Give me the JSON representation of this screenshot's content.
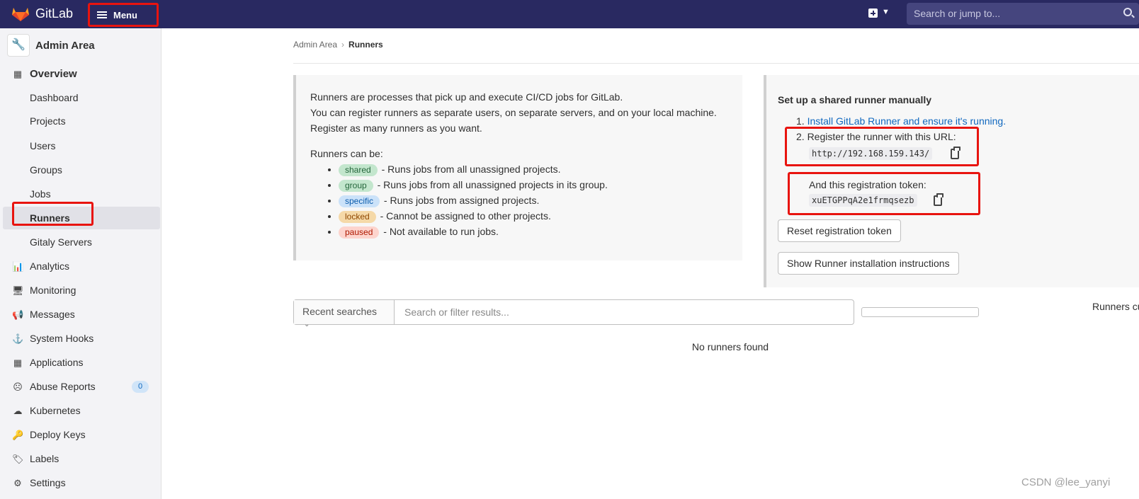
{
  "topbar": {
    "brand": "GitLab",
    "menu_label": "Menu",
    "search_placeholder": "Search or jump to..."
  },
  "sidebar": {
    "header": "Admin Area",
    "items": [
      {
        "label": "Overview",
        "icon": "overview-icon"
      },
      {
        "label": "Dashboard"
      },
      {
        "label": "Projects"
      },
      {
        "label": "Users"
      },
      {
        "label": "Groups"
      },
      {
        "label": "Jobs"
      },
      {
        "label": "Runners",
        "active": true
      },
      {
        "label": "Gitaly Servers"
      },
      {
        "label": "Analytics",
        "icon": "chart-icon"
      },
      {
        "label": "Monitoring",
        "icon": "monitor-icon"
      },
      {
        "label": "Messages",
        "icon": "megaphone-icon"
      },
      {
        "label": "System Hooks",
        "icon": "hook-icon"
      },
      {
        "label": "Applications",
        "icon": "grid-icon"
      },
      {
        "label": "Abuse Reports",
        "icon": "frown-icon",
        "badge": "0"
      },
      {
        "label": "Kubernetes",
        "icon": "kubernetes-icon"
      },
      {
        "label": "Deploy Keys",
        "icon": "key-icon"
      },
      {
        "label": "Labels",
        "icon": "label-icon"
      },
      {
        "label": "Settings",
        "icon": "gear-icon"
      }
    ]
  },
  "breadcrumb": {
    "parent": "Admin Area",
    "current": "Runners"
  },
  "info": {
    "line1": "Runners are processes that pick up and execute CI/CD jobs for GitLab.",
    "line2": "You can register runners as separate users, on separate servers, and on your local machine.",
    "line3": "Register as many runners as you want.",
    "can_be": "Runners can be:",
    "types": [
      {
        "pill": "shared",
        "desc": " - Runs jobs from all unassigned projects."
      },
      {
        "pill": "group",
        "desc": " - Runs jobs from all unassigned projects in its group."
      },
      {
        "pill": "specific",
        "desc": " - Runs jobs from assigned projects."
      },
      {
        "pill": "locked",
        "desc": " - Cannot be assigned to other projects."
      },
      {
        "pill": "paused",
        "desc": " - Not available to run jobs."
      }
    ]
  },
  "setup": {
    "title": "Set up a shared runner manually",
    "step1_num": "1.",
    "step1_link": "Install GitLab Runner and ensure it's running.",
    "step2": "2. Register the runner with this URL:",
    "url": "http://192.168.159.143/",
    "token_label": "And this registration token:",
    "token": "xuETGPPqA2e1frmqsezb",
    "reset_button": "Reset registration token",
    "instructions_button": "Show Runner installation instructions"
  },
  "filter": {
    "recent_searches": "Recent searches",
    "placeholder": "Search or filter results..."
  },
  "runners_count_label": "Runners cu",
  "empty_state": "No runners found",
  "watermark": "CSDN @lee_yanyi",
  "colors": {
    "topbar": "#292961",
    "link": "#1068bf",
    "highlight": "#e8140f"
  }
}
